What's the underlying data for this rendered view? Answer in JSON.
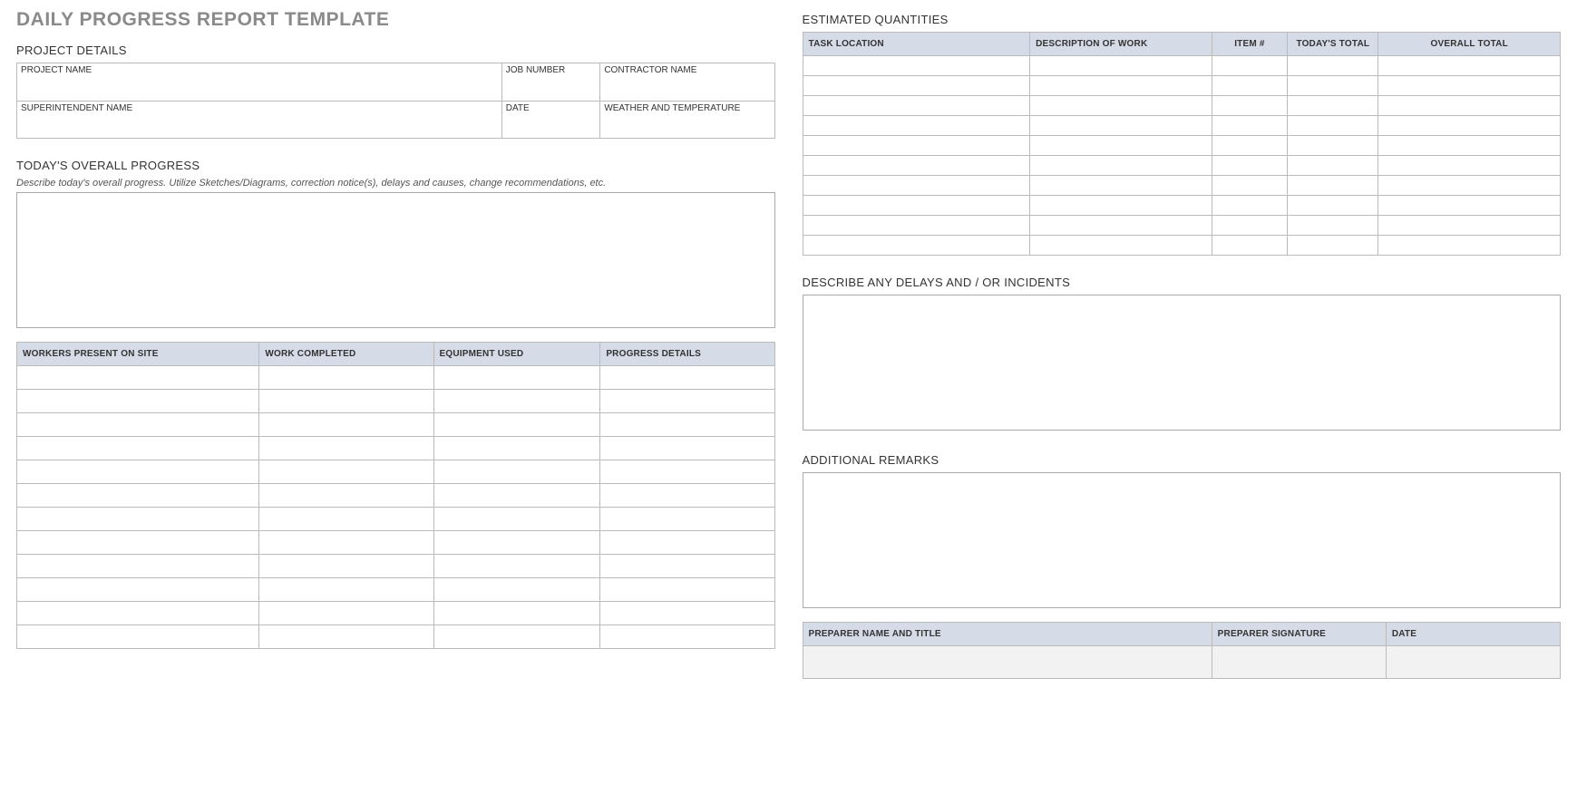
{
  "title": "DAILY PROGRESS REPORT TEMPLATE",
  "left": {
    "projectDetails": {
      "heading": "PROJECT DETAILS",
      "row1": {
        "projectName": "PROJECT NAME",
        "jobNumber": "JOB NUMBER",
        "contractorName": "CONTRACTOR NAME"
      },
      "row2": {
        "superintendent": "SUPERINTENDENT NAME",
        "date": "DATE",
        "weather": "WEATHER AND TEMPERATURE"
      }
    },
    "overall": {
      "heading": "TODAY'S OVERALL PROGRESS",
      "note": "Describe today's overall progress.  Utilize Sketches/Diagrams, correction notice(s), delays and causes, change recommendations, etc."
    },
    "progressTable": {
      "headers": [
        "WORKERS PRESENT ON SITE",
        "WORK COMPLETED",
        "EQUIPMENT USED",
        "PROGRESS DETAILS"
      ],
      "rowCount": 12
    }
  },
  "right": {
    "quantities": {
      "heading": "ESTIMATED QUANTITIES",
      "headers": [
        "TASK LOCATION",
        "DESCRIPTION OF WORK",
        "ITEM #",
        "TODAY'S TOTAL",
        "OVERALL TOTAL"
      ],
      "rowCount": 10
    },
    "delays": {
      "heading": "DESCRIBE ANY DELAYS AND / OR INCIDENTS"
    },
    "remarks": {
      "heading": "ADDITIONAL REMARKS"
    },
    "signoff": {
      "headers": [
        "PREPARER NAME AND TITLE",
        "PREPARER SIGNATURE",
        "DATE"
      ]
    }
  }
}
